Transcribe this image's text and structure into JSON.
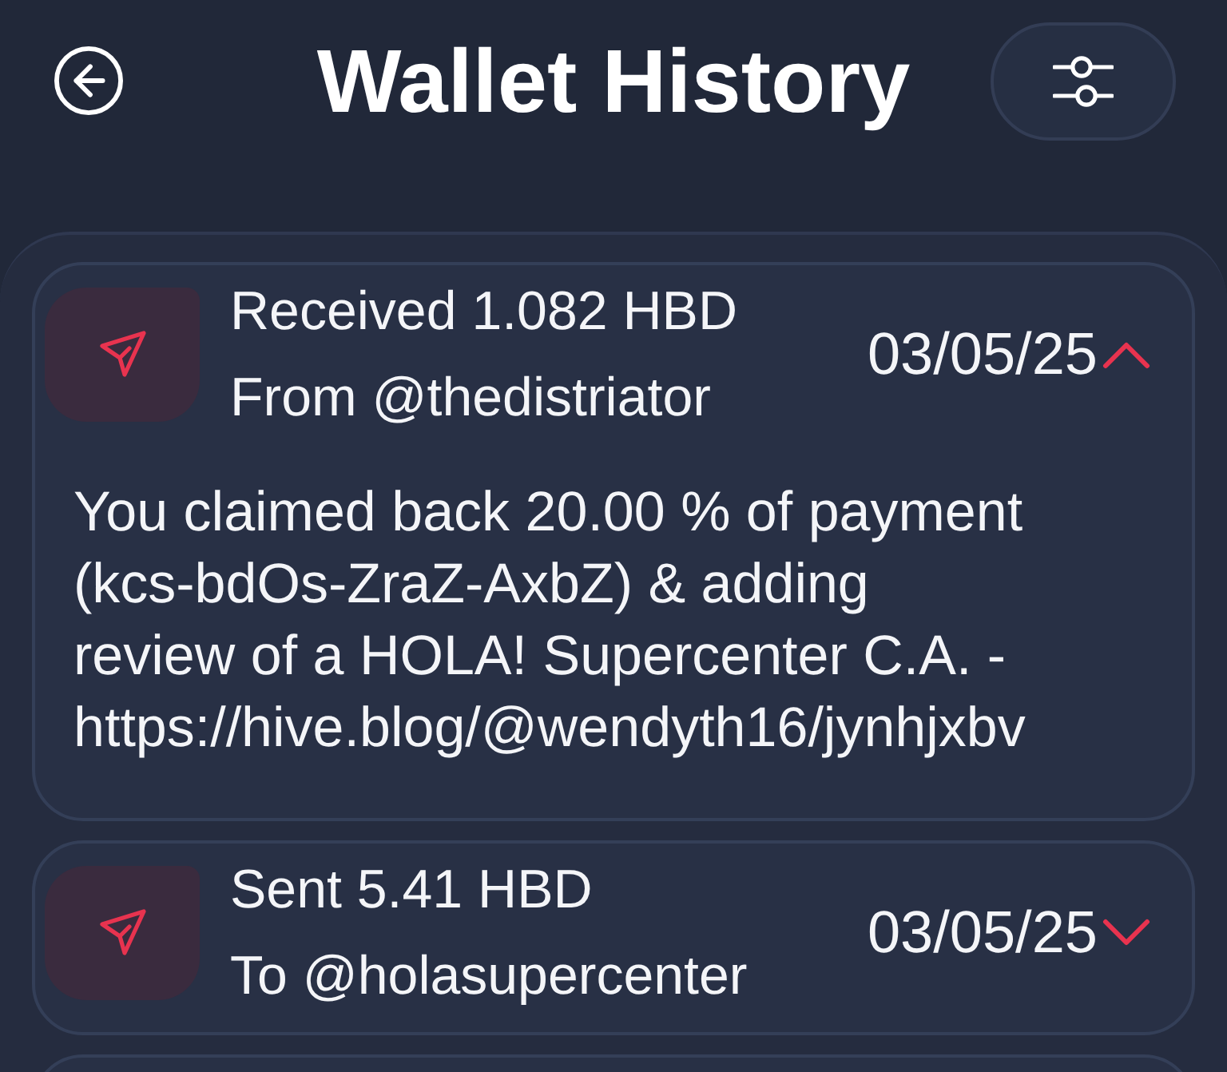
{
  "header": {
    "title": "Wallet History"
  },
  "transactions": [
    {
      "title": "Received 1.082 HBD",
      "party": "From @thedistriator",
      "date": "03/05/25",
      "expanded": true,
      "memo": "You claimed back 20.00 % of payment (kcs-bdOs-ZraZ-AxbZ) & adding review of a HOLA! Supercenter C.A. - https://hive.blog/@wendyth16/jynhjxbv"
    },
    {
      "title": "Sent 5.41 HBD",
      "party": "To @holasupercenter",
      "date": "03/05/25",
      "expanded": false
    }
  ]
}
